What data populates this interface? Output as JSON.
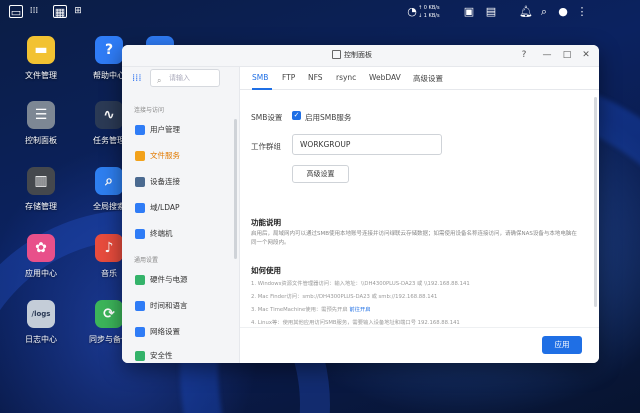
{
  "topbar": {
    "left_icons": [
      "desktop-icon",
      "apps-grid-icon",
      "app-window-icon",
      "window-grid-icon"
    ],
    "speed_up": "↑ 0 KB/s",
    "speed_down": "↓ 1 KB/s",
    "right_icons": [
      "task-monitor-icon",
      "network-speed-icon",
      "sidebar-icon",
      "storage-icon",
      "notification-icon",
      "search-icon",
      "user-icon",
      "more-icon"
    ]
  },
  "desktop": {
    "icons": [
      {
        "label": "文件管理",
        "icon": "folder-icon",
        "color": "#f2c232"
      },
      {
        "label": "帮助中心",
        "icon": "help-icon",
        "color": "#2f7cf6"
      },
      {
        "label": "控制面板",
        "icon": "control-panel-icon",
        "color": "#7d8794"
      },
      {
        "label": "任务管理",
        "icon": "task-manager-icon",
        "color": "#2b3a55"
      },
      {
        "label": "存储管理",
        "icon": "storage-manager-icon",
        "color": "#45484d"
      },
      {
        "label": "全局搜索",
        "icon": "global-search-icon",
        "color": "#2e7ff0"
      },
      {
        "label": "应用中心",
        "icon": "app-center-icon",
        "color": "#e8508a"
      },
      {
        "label": "音乐",
        "icon": "music-icon",
        "color": "#e84c3d"
      },
      {
        "label": "日志中心",
        "icon": "logs-icon",
        "color": "#c4cdd8"
      },
      {
        "label": "同步与备份",
        "icon": "sync-backup-icon",
        "color": "#3cb55a"
      }
    ],
    "logs_text": "/logs"
  },
  "window": {
    "title": "控制面板",
    "controls": [
      "?",
      "—",
      "□",
      "✕"
    ],
    "search_placeholder": "请输入",
    "sidebar": {
      "group1": "连接与访问",
      "group2": "通用设置",
      "items": [
        {
          "label": "用户管理",
          "icon": "user-management-icon",
          "color": "#2f7cf6"
        },
        {
          "label": "文件服务",
          "icon": "file-service-icon",
          "color": "#f2a21b"
        },
        {
          "label": "设备连接",
          "icon": "device-connect-icon",
          "color": "#4b6a90"
        },
        {
          "label": "域/LDAP",
          "icon": "domain-ldap-icon",
          "color": "#2f7cf6"
        },
        {
          "label": "终端机",
          "icon": "terminal-icon",
          "color": "#2f7cf6"
        },
        {
          "label": "硬件与电源",
          "icon": "hardware-power-icon",
          "color": "#34b36a"
        },
        {
          "label": "时间和语言",
          "icon": "time-language-icon",
          "color": "#2f7cf6"
        },
        {
          "label": "网络设置",
          "icon": "network-settings-icon",
          "color": "#2f7cf6"
        },
        {
          "label": "安全性",
          "icon": "security-icon",
          "color": "#34b36a"
        }
      ]
    },
    "tabs": [
      "SMB",
      "FTP",
      "NFS",
      "rsync",
      "WebDAV",
      "高级设置"
    ],
    "smb": {
      "setting_label": "SMB设置",
      "enable_label": "启用SMB服务",
      "workgroup_label": "工作群组",
      "workgroup_value": "WORKGROUP",
      "advanced_button": "高级设置",
      "func_title": "功能说明",
      "func_text": "启用后，局域网内可以通过SMB使用本地账号连接并访问绿联云存储数据；如需使用设备名称连接访问，请确保NAS设备与本地电脑在同一个网段内。",
      "howto_title": "如何使用",
      "steps": [
        {
          "text": "1. Windows资源文件管理器访问：输入地址：\\\\DH4300PLUS-DA23 或 \\\\192.168.88.141",
          "link": ""
        },
        {
          "text": "2. Mac Finder访问：smb://DH4300PLUS-DA23 或 smb://192.168.88.141",
          "link": ""
        },
        {
          "text": "3. Mac TimeMachine使用：需预先开启 ",
          "link": "前往开启"
        },
        {
          "text": "4. Linux等：使用其他应用访问SMB服务，需要输入设备地址和端口号 192.168.88.141",
          "link": ""
        }
      ],
      "apply_button": "应用"
    }
  }
}
